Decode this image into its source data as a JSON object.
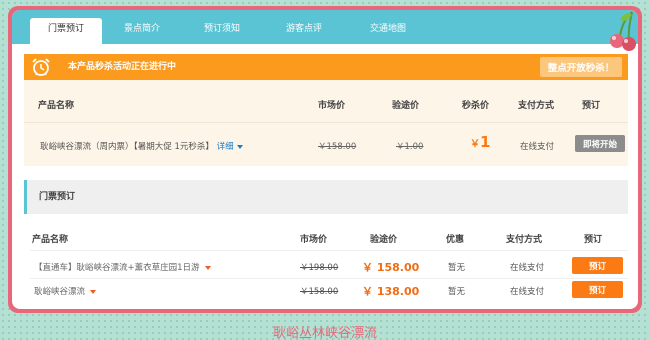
{
  "tabs": [
    {
      "label": "门票预订"
    },
    {
      "label": "景点简介"
    },
    {
      "label": "预订须知"
    },
    {
      "label": "游客点评"
    },
    {
      "label": "交通地图"
    }
  ],
  "flash_sale": {
    "banner": "本产品秒杀活动正在进行中",
    "action_button": "整点开放秒杀！",
    "headers": {
      "name": "产品名称",
      "market": "市场价",
      "verify": "验途价",
      "flash": "秒杀价",
      "payment": "支付方式",
      "book": "预订"
    },
    "product": {
      "name": "耿峪峡谷漂流（周内票）【暑期大促 1元秒杀】",
      "detail_link": "详细",
      "market_price": "￥158.00",
      "verify_price": "￥1.00",
      "currency": "￥",
      "flash_price": "1",
      "payment": "在线支付",
      "button": "即将开始"
    }
  },
  "ticket_section": {
    "title": "门票预订",
    "headers": {
      "name": "产品名称",
      "market": "市场价",
      "verify": "验途价",
      "discount": "优惠",
      "payment": "支付方式",
      "book": "预订"
    },
    "rows": [
      {
        "name": "【直通车】耿峪峡谷漂流+薰衣草庄园1日游",
        "market_price": "￥198.00",
        "verify_price": "￥ 158.00",
        "discount": "暂无",
        "payment": "在线支付",
        "button": "预订"
      },
      {
        "name": "耿峪峡谷漂流",
        "market_price": "￥158.00",
        "verify_price": "￥ 138.00",
        "discount": "暂无",
        "payment": "在线支付",
        "button": "预订"
      }
    ]
  },
  "footer": {
    "text": "耿峪丛林峡谷漂流"
  },
  "colors": {
    "tab_bar": "#5bc4d4",
    "frame": "#e9677a",
    "flash_bar": "#fb9a1c",
    "price_orange": "#fb7a14",
    "disabled_button": "#8c8c8c"
  },
  "icons": {
    "alarm": "alarm-clock-icon",
    "cherry": "cherry-icon",
    "caret": "caret-down-icon"
  }
}
